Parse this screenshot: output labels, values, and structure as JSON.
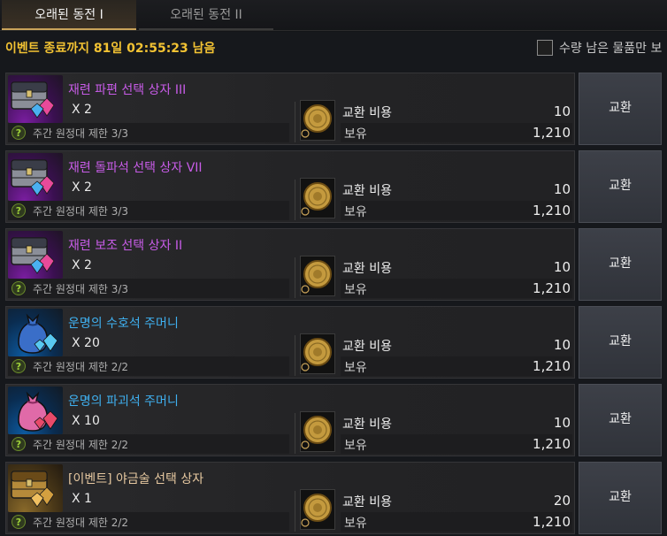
{
  "tabs": [
    {
      "label": "오래된 동전 I",
      "active": true
    },
    {
      "label": "오래된 동전 II",
      "active": false
    }
  ],
  "timer": "이벤트 종료까지 81일 02:55:23 남음",
  "filter": {
    "label": "수량 남은 물품만 보",
    "checked": false
  },
  "cost_label": "교환 비용",
  "own_label": "보유",
  "button_label": "교환",
  "items": [
    {
      "name": "재련 파편 선택 상자 III",
      "name_color": "purple",
      "icon": "chest-icon",
      "qty": "X 2",
      "limit": "주간 원정대 제한 3/3",
      "cost": "10",
      "owned": "1,210"
    },
    {
      "name": "재련 돌파석 선택 상자 VII",
      "name_color": "purple",
      "icon": "chest-icon",
      "qty": "X 2",
      "limit": "주간 원정대 제한 3/3",
      "cost": "10",
      "owned": "1,210"
    },
    {
      "name": "재련 보조 선택 상자 II",
      "name_color": "purple",
      "icon": "chest-icon",
      "qty": "X 2",
      "limit": "주간 원정대 제한 3/3",
      "cost": "10",
      "owned": "1,210"
    },
    {
      "name": "운명의 수호석 주머니",
      "name_color": "blue",
      "icon": "pouch-icon",
      "qty": "X 20",
      "limit": "주간 원정대 제한 2/2",
      "cost": "10",
      "owned": "1,210"
    },
    {
      "name": "운명의 파괴석 주머니",
      "name_color": "blue",
      "icon": "pouch-icon",
      "qty": "X 10",
      "limit": "주간 원정대 제한 2/2",
      "cost": "10",
      "owned": "1,210"
    },
    {
      "name": "[이벤트] 야금술 선택 상자",
      "name_color": "gold",
      "icon": "chest-icon",
      "qty": "X 1",
      "limit": "주간 원정대 제한 2/2",
      "cost": "20",
      "owned": "1,210"
    }
  ],
  "colors": {
    "accent_gold": "#f2c233",
    "tab_underline": "#c9a35a",
    "purple_name": "#c85ce8",
    "blue_name": "#3fb0f0",
    "gold_name": "#e6c8a0",
    "check_green": "#9fd23a"
  }
}
